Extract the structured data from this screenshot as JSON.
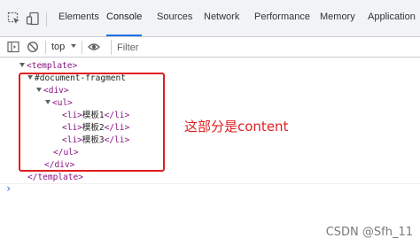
{
  "tabs": {
    "elements": "Elements",
    "console": "Console",
    "sources": "Sources",
    "network": "Network",
    "performance": "Performance",
    "memory": "Memory",
    "application": "Application"
  },
  "toolbar": {
    "context": "top",
    "filter_placeholder": "Filter"
  },
  "dom_tree": {
    "template_open": "<template>",
    "fragment": "#document-fragment",
    "div_open": "<div>",
    "ul_open": "<ul>",
    "li1_open": "<li>",
    "li1_text": "模板1",
    "li1_close": "</li>",
    "li2_open": "<li>",
    "li2_text": "模板2",
    "li2_close": "</li>",
    "li3_open": "<li>",
    "li3_text": "模板3",
    "li3_close": "</li>",
    "ul_close": "</ul>",
    "div_close": "</div>",
    "template_close": "</template>"
  },
  "annotation": "这部分是content",
  "prompt_symbol": "›",
  "watermark": "CSDN @Sfh_11",
  "colors": {
    "active_tab": "#1a73e8",
    "tag": "#881280",
    "annotation": "#e01e1e"
  }
}
